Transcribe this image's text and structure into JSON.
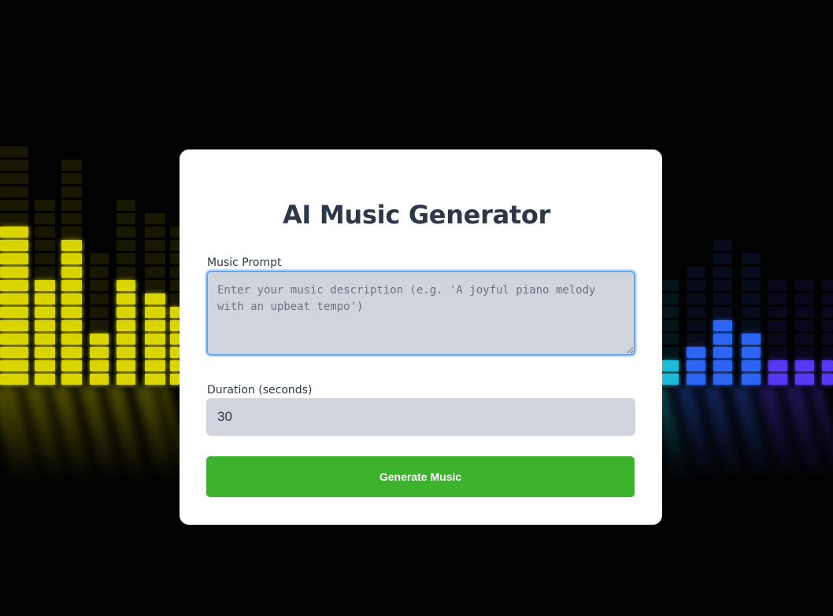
{
  "app": {
    "title": "AI Music Generator"
  },
  "form": {
    "prompt_label": "Music Prompt",
    "prompt_placeholder": "Enter your music description (e.g. 'A joyful piano melody with an upbeat tempo')",
    "prompt_value": "",
    "duration_label": "Duration (seconds)",
    "duration_value": "30",
    "generate_label": "Generate Music"
  },
  "background": {
    "description": "audio-equalizer-image"
  },
  "colors": {
    "card_bg": "#ffffff",
    "title": "#2d3748",
    "input_bg": "#d0d5dd",
    "focus_border": "#63a4f0",
    "button": "#3db22c",
    "button_text": "#ffffff",
    "eq_yellow": "#e5e000",
    "eq_blue": "#2f6bff",
    "eq_cyan": "#1ec8e6",
    "eq_violet": "#5a3cff"
  }
}
